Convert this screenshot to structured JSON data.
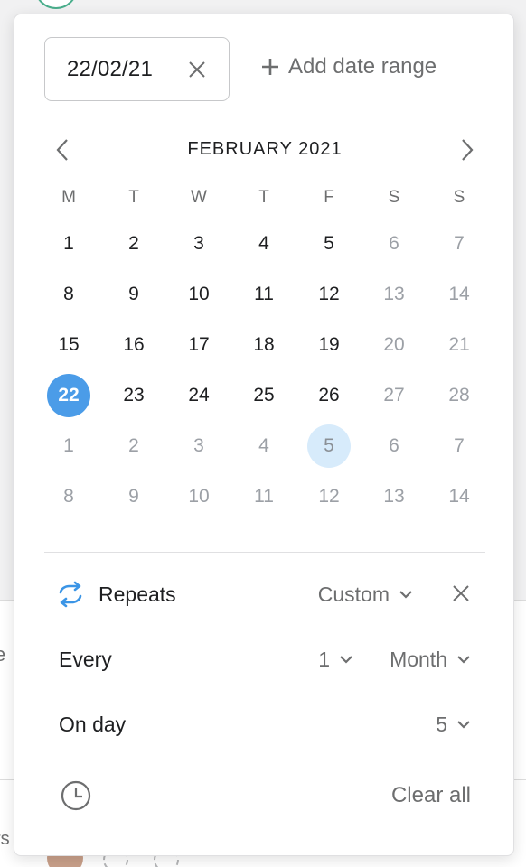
{
  "date_input": {
    "value": "22/02/21"
  },
  "add_range": {
    "label": "Add date range"
  },
  "calendar": {
    "month_title": "FEBRUARY 2021",
    "weekdays": [
      "M",
      "T",
      "W",
      "T",
      "F",
      "S",
      "S"
    ],
    "weeks": [
      [
        {
          "d": "1",
          "s": "normal"
        },
        {
          "d": "2",
          "s": "normal"
        },
        {
          "d": "3",
          "s": "normal"
        },
        {
          "d": "4",
          "s": "normal"
        },
        {
          "d": "5",
          "s": "normal"
        },
        {
          "d": "6",
          "s": "muted"
        },
        {
          "d": "7",
          "s": "muted"
        }
      ],
      [
        {
          "d": "8",
          "s": "normal"
        },
        {
          "d": "9",
          "s": "normal"
        },
        {
          "d": "10",
          "s": "normal"
        },
        {
          "d": "11",
          "s": "normal"
        },
        {
          "d": "12",
          "s": "normal"
        },
        {
          "d": "13",
          "s": "muted"
        },
        {
          "d": "14",
          "s": "muted"
        }
      ],
      [
        {
          "d": "15",
          "s": "normal"
        },
        {
          "d": "16",
          "s": "normal"
        },
        {
          "d": "17",
          "s": "normal"
        },
        {
          "d": "18",
          "s": "normal"
        },
        {
          "d": "19",
          "s": "normal"
        },
        {
          "d": "20",
          "s": "muted"
        },
        {
          "d": "21",
          "s": "muted"
        }
      ],
      [
        {
          "d": "22",
          "s": "selected"
        },
        {
          "d": "23",
          "s": "normal"
        },
        {
          "d": "24",
          "s": "normal"
        },
        {
          "d": "25",
          "s": "normal"
        },
        {
          "d": "26",
          "s": "normal"
        },
        {
          "d": "27",
          "s": "muted"
        },
        {
          "d": "28",
          "s": "muted"
        }
      ],
      [
        {
          "d": "1",
          "s": "muted"
        },
        {
          "d": "2",
          "s": "muted"
        },
        {
          "d": "3",
          "s": "muted"
        },
        {
          "d": "4",
          "s": "muted"
        },
        {
          "d": "5",
          "s": "highlight"
        },
        {
          "d": "6",
          "s": "muted"
        },
        {
          "d": "7",
          "s": "muted"
        }
      ],
      [
        {
          "d": "8",
          "s": "muted"
        },
        {
          "d": "9",
          "s": "muted"
        },
        {
          "d": "10",
          "s": "muted"
        },
        {
          "d": "11",
          "s": "muted"
        },
        {
          "d": "12",
          "s": "muted"
        },
        {
          "d": "13",
          "s": "muted"
        },
        {
          "d": "14",
          "s": "muted"
        }
      ]
    ]
  },
  "repeats": {
    "label": "Repeats",
    "mode": "Custom"
  },
  "every": {
    "label": "Every",
    "interval": "1",
    "unit": "Month"
  },
  "on_day": {
    "label": "On day",
    "value": "5"
  },
  "footer": {
    "clear_all": "Clear all"
  },
  "background": {
    "fragment_left": "e",
    "fragment_bottom": "rs"
  },
  "colors": {
    "selected": "#4b9ce8",
    "highlight": "#d7ebfb",
    "accent_icon": "#3b95e6"
  }
}
